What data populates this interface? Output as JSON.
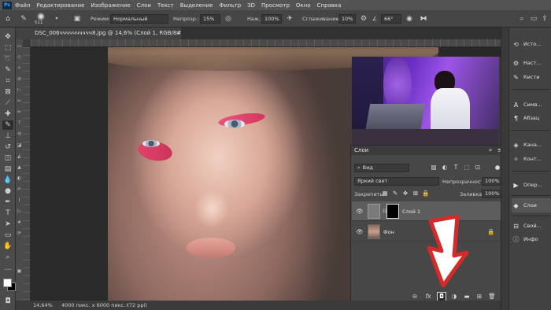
{
  "menubar": {
    "logo": "Ps",
    "items": [
      "Файл",
      "Редактирование",
      "Изображение",
      "Слои",
      "Текст",
      "Выделение",
      "Фильтр",
      "3D",
      "Просмотр",
      "Окно",
      "Справка"
    ]
  },
  "options": {
    "brush_size": "511",
    "mode_label": "Режим:",
    "mode_value": "Нормальный",
    "opacity_label": "Непрозр.:",
    "opacity_value": "15%",
    "pressure_label": "Наж.:",
    "pressure_value": "100%",
    "smoothing_label": "Сглаживание:",
    "smoothing_value": "10%",
    "angle_value": "66°"
  },
  "document": {
    "tab_title": "DSC_006чччччччччч8.jpg @ 14,6% (Слой 1, RGB/8#) *",
    "close": "×"
  },
  "status": {
    "zoom": "14,64%",
    "info": "4000 пикс. x 6000 пикс. (72 ppi)"
  },
  "dock": {
    "items": [
      {
        "icon": "history-icon",
        "label": "Исто..."
      },
      {
        "icon": "layers-icon",
        "label": "Наст..."
      },
      {
        "icon": "brush-icon",
        "label": "Кисти"
      },
      {
        "icon": "symbol-icon",
        "label": "Симв..."
      },
      {
        "icon": "paragraph-icon",
        "label": "Абзац"
      },
      {
        "icon": "channels-icon",
        "label": "Кана..."
      },
      {
        "icon": "paths-icon",
        "label": "Конт..."
      },
      {
        "icon": "actions-icon",
        "label": "Опер..."
      },
      {
        "icon": "layers-panel-icon",
        "label": "Слои"
      },
      {
        "icon": "properties-icon",
        "label": "Свой..."
      },
      {
        "icon": "info-icon",
        "label": "Инфо"
      }
    ]
  },
  "layers_panel": {
    "title": "Слои",
    "filter_value": "Вид",
    "blend_mode": "Яркий свет",
    "opacity_label": "Непрозрачность:",
    "opacity_value": "100%",
    "lock_label": "Закрепить:",
    "fill_label": "Заливка:",
    "fill_value": "100%",
    "layers": [
      {
        "name": "Слой 1",
        "selected": true
      },
      {
        "name": "Фон",
        "selected": false
      }
    ]
  },
  "colors": {
    "accent_arrow": "#d52a2a",
    "foreground": "#ffffff",
    "background": "#000000"
  }
}
